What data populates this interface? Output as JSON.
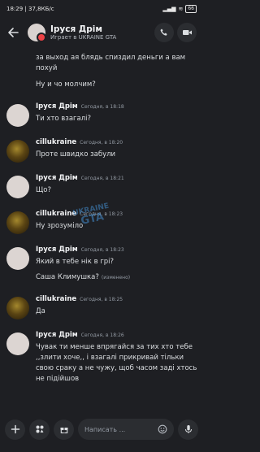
{
  "status_bar": {
    "time": "18:29",
    "speed": "37,8КБ/с",
    "battery": "66"
  },
  "header": {
    "name": "Іруся Дрім",
    "subtitle": "Играет в UKRAINE GTA"
  },
  "messages": {
    "partial_top": "за выход ая блядь спиздил деньги а вам похуй",
    "partial_top2": "Ну и чо молчим?",
    "groups": [
      {
        "author": "Іруся Дрім",
        "time": "Сегодня, в 18:18",
        "lines": [
          "Ти хто взагалі?"
        ]
      },
      {
        "author": "cillukraine",
        "time": "Сегодня, в 18:20",
        "lines": [
          "Проте швидко забули"
        ]
      },
      {
        "author": "Іруся Дрім",
        "time": "Сегодня, в 18:21",
        "lines": [
          "Що?"
        ]
      },
      {
        "author": "cillukraine",
        "time": "Сегодня, в 18:23",
        "lines": [
          "Ну зрозуміло"
        ]
      },
      {
        "author": "Іруся Дрім",
        "time": "Сегодня, в 18:23",
        "lines": [
          "Який в тебе нік в грі?",
          "Саша Климушка?"
        ],
        "edited": "(изменено)"
      },
      {
        "author": "cillukraine",
        "time": "Сегодня, в 18:25",
        "lines": [
          "Да"
        ]
      },
      {
        "author": "Іруся Дрім",
        "time": "Сегодня, в 18:26",
        "lines": [
          "Чувак ти менше впрягайся за тих хто тебе ,,злити хоче,, і взагалі прикривай тільки свою сраку а не чужу, щоб часом заді хтось не підійшов"
        ]
      }
    ]
  },
  "watermark": {
    "line1": "UKRAINE",
    "line2": "GTA"
  },
  "input": {
    "placeholder": "Написать ..."
  },
  "colors": {
    "background": "#1e1f23",
    "status_dnd": "#ed4245"
  }
}
